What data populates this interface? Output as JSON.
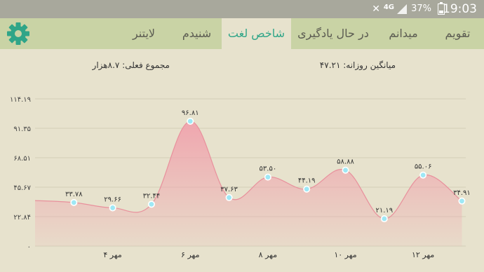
{
  "status_bar": {
    "time": "19:03",
    "battery": "37%",
    "network": "4G",
    "icons": [
      "mute-icon",
      "signal-icon",
      "battery-icon"
    ]
  },
  "tabs": [
    {
      "label": "تقویم",
      "active": false
    },
    {
      "label": "میدانم",
      "active": false
    },
    {
      "label": "در حال یادگیری",
      "active": false
    },
    {
      "label": "شاخص لغت",
      "active": true
    },
    {
      "label": "شنیدم",
      "active": false
    },
    {
      "label": "لایتنر",
      "active": false
    }
  ],
  "settings_icon": "gear-icon",
  "stats": {
    "daily_average": "میانگین روزانه: ۴۷.۲۱",
    "total_current": "مجموع فعلی: ۸.۷هزار"
  },
  "colors": {
    "accent": "#2fa588",
    "tab_bar": "#c9d3a5",
    "background": "#e7e2cd",
    "area_fill": "#f0a3ad",
    "point": "#9ee8f5"
  },
  "chart_data": {
    "type": "area",
    "x": [
      3,
      4,
      5,
      6,
      7,
      8,
      9,
      10,
      11,
      12,
      13
    ],
    "values": [
      33.78,
      29.66,
      32.44,
      96.81,
      37.63,
      53.5,
      44.19,
      58.88,
      21.19,
      55.06,
      34.91
    ],
    "point_labels": [
      "۳۳.۷۸",
      "۲۹.۶۶",
      "۳۲.۴۴",
      "۹۶.۸۱",
      "۳۷.۶۳",
      "۵۳.۵۰",
      "۴۴.۱۹",
      "۵۸.۸۸",
      "۲۱.۱۹",
      "۵۵.۰۶",
      "۳۴.۹۱"
    ],
    "y_ticks": [
      0,
      22.84,
      45.67,
      68.51,
      91.35,
      114.19
    ],
    "y_tick_labels": [
      "۰",
      "۲۲.۸۴",
      "۴۵.۶۷",
      "۶۸.۵۱",
      "۹۱.۳۵",
      "۱۱۴.۱۹"
    ],
    "x_ticks": [
      4,
      6,
      8,
      10,
      12
    ],
    "x_tick_labels": [
      "۴ مهر",
      "۶ مهر",
      "۸ مهر",
      "۱۰ مهر",
      "۱۲ مهر"
    ],
    "x_range": [
      2.0,
      13.1
    ],
    "ylim": [
      0,
      114.19
    ],
    "grid": true,
    "legend": "none"
  }
}
